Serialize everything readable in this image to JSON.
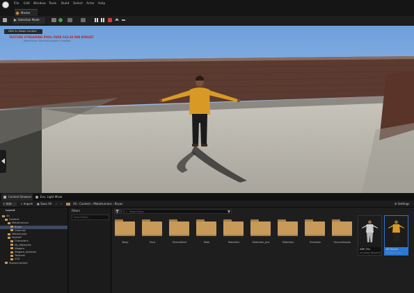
{
  "menu": {
    "items": [
      "File",
      "Edit",
      "Window",
      "Tools",
      "Build",
      "Select",
      "Actor",
      "Help"
    ]
  },
  "level_tab": {
    "label": "Master"
  },
  "toolbar": {
    "mode_label": "Selection Mode"
  },
  "viewport": {
    "perf_badge": "DDX 5x Model Context",
    "warning": "TEXTURE STREAMING POOL OVER 533.40 MiB BUDGET",
    "sub_warning": "MetaHuman Animator plugin is enabled"
  },
  "bottom_tabs": {
    "content_browser": "Content Browser",
    "env_light": "Env. Light Mixer"
  },
  "cb_toolbar": {
    "add": "Add",
    "import": "Import",
    "save_all": "Save All",
    "path": [
      "All",
      "Content",
      "MetaHumans",
      "Bryan"
    ],
    "settings": "Settings"
  },
  "tree": {
    "header": "Layer8",
    "items": [
      {
        "label": "All",
        "level": 0
      },
      {
        "label": "Content",
        "level": 1
      },
      {
        "label": "MetaHumans",
        "level": 2
      },
      {
        "label": "Bryan",
        "level": 3,
        "selected": true
      },
      {
        "label": "Common",
        "level": 3
      },
      {
        "label": "MotionLogic",
        "level": 2
      },
      {
        "label": "MyStuff",
        "level": 2
      },
      {
        "label": "Characters",
        "level": 3
      },
      {
        "label": "My_Materials",
        "level": 3
      },
      {
        "label": "Niagara",
        "level": 3
      },
      {
        "label": "Niagara_Systems",
        "level": 3
      },
      {
        "label": "Textures",
        "level": 3
      },
      {
        "label": "VCS",
        "level": 3
      },
      {
        "label": "StarterContent",
        "level": 1
      }
    ]
  },
  "filters": {
    "title": "Filters",
    "search_placeholder": "Search Bryan"
  },
  "asset_search": {
    "placeholder": "Search Bryan"
  },
  "folders": [
    "Body",
    "Face",
    "FemaleHair",
    "Male",
    "Materials",
    "Materials_phs",
    "Materials",
    "Previews",
    "SourceAssets"
  ],
  "assets": [
    {
      "name": "ABP_Trix",
      "kind": "Animation Blueprint"
    },
    {
      "name": "BP_Bryan",
      "kind": "Blueprint Class",
      "selected": true
    }
  ],
  "colors": {
    "accent": "#2a78d6",
    "folder": "#c79a5a",
    "sky": "#8fb4e0",
    "warning_text": "#c81e1e"
  }
}
